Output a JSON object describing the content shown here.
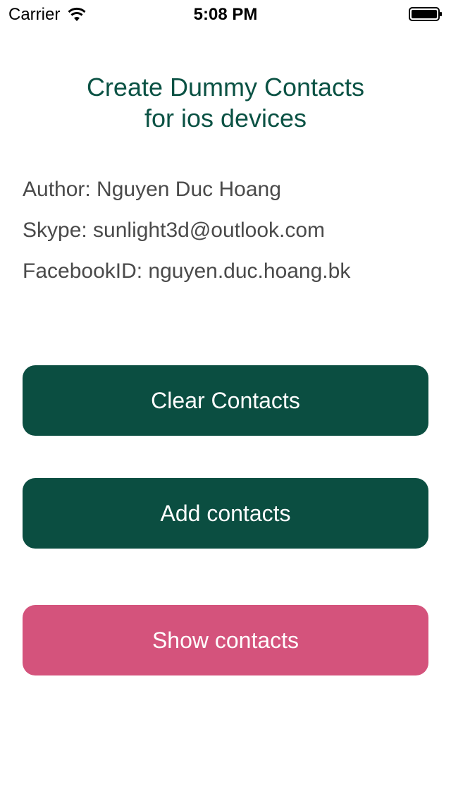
{
  "status_bar": {
    "carrier": "Carrier",
    "time": "5:08 PM",
    "wifi_icon": "wifi-icon",
    "battery_icon": "battery-icon",
    "battery_level": 1.0
  },
  "title": {
    "line1": "Create Dummy Contacts",
    "line2": "for ios devices",
    "color": "#0b5244"
  },
  "info": {
    "author": "Author: Nguyen Duc Hoang",
    "skype": "Skype: sunlight3d@outlook.com",
    "facebook": "FacebookID: nguyen.duc.hoang.bk"
  },
  "buttons": {
    "clear": "Clear Contacts",
    "add": "Add contacts",
    "show": "Show contacts"
  },
  "colors": {
    "primary": "#0b4e41",
    "accent": "#d4537c",
    "info_text": "#4a4a4a"
  }
}
